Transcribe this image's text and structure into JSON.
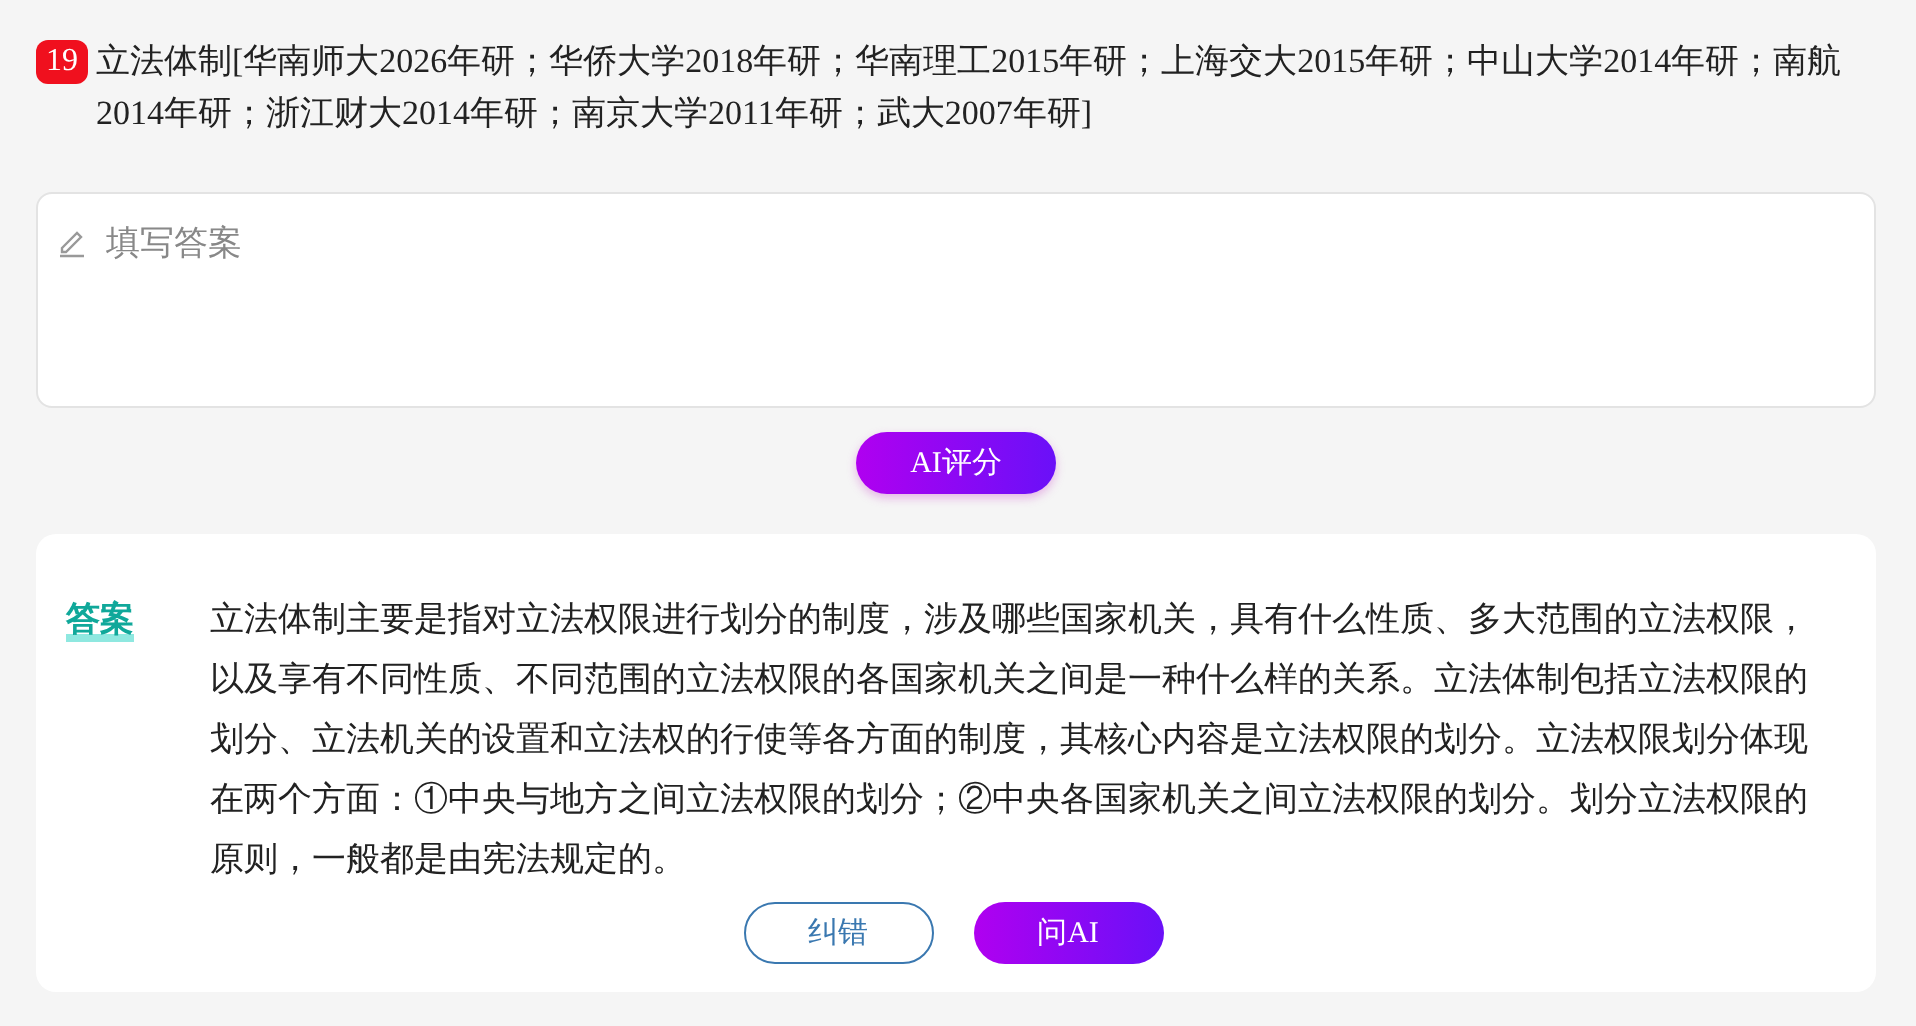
{
  "question": {
    "number": "19",
    "text": "立法体制[华南师大2026年研；华侨大学2018年研；华南理工2015年研；上海交大2015年研；中山大学2014年研；南航2014年研；浙江财大2014年研；南京大学2011年研；武大2007年研]"
  },
  "answer_field": {
    "placeholder": "填写答案"
  },
  "ai_score_button": "AI评分",
  "answer": {
    "label": "答案",
    "text": "立法体制主要是指对立法权限进行划分的制度，涉及哪些国家机关，具有什么性质、多大范围的立法权限，以及享有不同性质、不同范围的立法权限的各国家机关之间是一种什么样的关系。立法体制包括立法权限的划分、立法机关的设置和立法权的行使等各方面的制度，其核心内容是立法权限的划分。立法权限划分体现在两个方面：①中央与地方之间立法权限的划分；②中央各国家机关之间立法权限的划分。划分立法权限的原则，一般都是由宪法规定的。"
  },
  "buttons": [
    {
      "kind": "outline",
      "label": "纠错"
    },
    {
      "kind": "gradient",
      "label": "问AI"
    }
  ]
}
